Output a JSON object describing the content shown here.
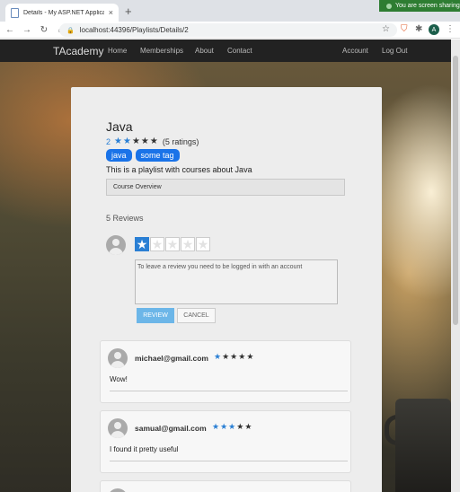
{
  "browser": {
    "tab_title": "Details - My ASP.NET Application",
    "tab_close": "×",
    "new_tab": "+",
    "url": "localhost:44396/Playlists/Details/2",
    "share_banner": "You are screen sharing",
    "avatar_letter": "A"
  },
  "navbar": {
    "brand": "TAcademy",
    "links": [
      "Home",
      "Memberships",
      "About",
      "Contact"
    ],
    "right_links": [
      "Account",
      "Log Out"
    ]
  },
  "playlist": {
    "title": "Java",
    "rating_value": "2",
    "rating_stars": 2,
    "rating_total_stars": 5,
    "rating_count": "(5 ratings)",
    "tags": [
      "java",
      "some tag"
    ],
    "description": "This is a playlist with courses about Java",
    "overview_label": "Course Overview"
  },
  "reviews": {
    "count_label": "5 Reviews",
    "form": {
      "selected_stars": 1,
      "total_stars": 5,
      "textarea_value": "To leave a review you need to be logged in with an account",
      "review_button": "REVIEW",
      "cancel_button": "CANCEL"
    },
    "items": [
      {
        "email": "michael@gmail.com",
        "stars": 1,
        "text": "Wow!"
      },
      {
        "email": "samual@gmail.com",
        "stars": 3,
        "text": "I found it pretty useful"
      }
    ]
  },
  "colors": {
    "accent": "#2a7fd4",
    "tag": "#1a73e8",
    "navbar": "#222222"
  }
}
